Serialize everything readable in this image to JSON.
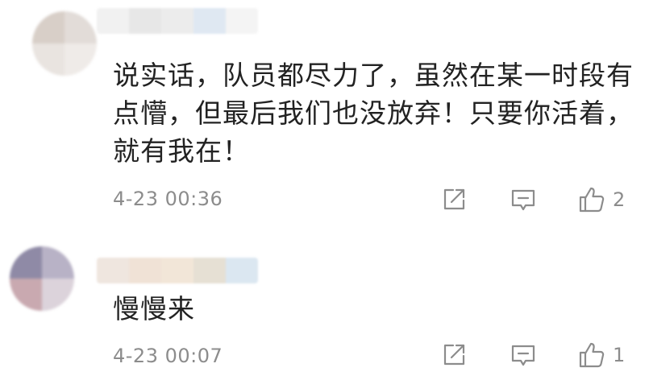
{
  "comments": [
    {
      "avatar_colors": [
        "#d8cfc8",
        "#e2dcd8",
        "#e9e4e0",
        "#efebe8"
      ],
      "name_colors": [
        "#f1f1f1",
        "#e7e7e7",
        "#ececec",
        "#dfe8f2",
        "#f4f4f4"
      ],
      "text": "说实话，队员都尽力了，虽然在某一时段有点懵，但最后我们也没放弃！只要你活着，就有我在！",
      "timestamp": "4-23 00:36",
      "like_count": "2",
      "icons": {
        "share": "share-icon",
        "reply": "comment-icon",
        "like": "thumbs-up-icon"
      }
    },
    {
      "avatar_colors": [
        "#8f8aa6",
        "#b8b2c6",
        "#c9a9b0",
        "#dcd3db"
      ],
      "name_colors": [
        "#efe6df",
        "#f0e2d6",
        "#f2e6d8",
        "#e6e0d4",
        "#dbe7f1"
      ],
      "text": "慢慢来",
      "timestamp": "4-23 00:07",
      "like_count": "1",
      "icons": {
        "share": "share-icon",
        "reply": "comment-icon",
        "like": "thumbs-up-icon"
      }
    }
  ]
}
